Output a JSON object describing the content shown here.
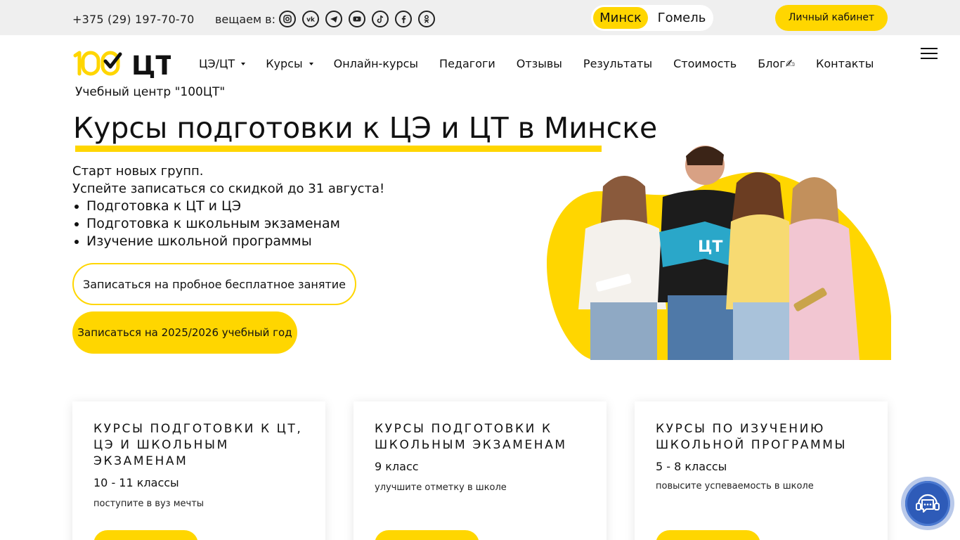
{
  "topbar": {
    "phone": "+375 (29) 197-70-70",
    "broadcast_label": "вещаем в:",
    "socials": [
      "instagram-icon",
      "vk-icon",
      "telegram-icon",
      "youtube-icon",
      "tiktok-icon",
      "facebook-icon",
      "odnoklassniki-icon"
    ],
    "cities": {
      "active": "Минск",
      "other": "Гомель"
    },
    "cabinet_label": "Личный кабинет"
  },
  "nav": {
    "logo_text": "100ЦТ",
    "items": [
      {
        "label": "ЦЭ/ЦТ",
        "dropdown": true
      },
      {
        "label": "Курсы",
        "dropdown": true
      },
      {
        "label": "Онлайн-курсы",
        "dropdown": false
      },
      {
        "label": "Педагоги",
        "dropdown": false
      },
      {
        "label": "Отзывы",
        "dropdown": false
      },
      {
        "label": "Результаты",
        "dropdown": false
      },
      {
        "label": "Стоимость",
        "dropdown": false
      },
      {
        "label": "Блог✍",
        "dropdown": false
      },
      {
        "label": "Контакты",
        "dropdown": false
      }
    ]
  },
  "hero": {
    "subtitle": "Учебный центр \"100ЦТ\"",
    "title": "Курсы подготовки к ЦЭ и ЦТ в Минске",
    "lead_line1": "Старт новых групп.",
    "lead_line2": "Успейте записаться со скидкой до 31 августа!",
    "bullets": [
      "Подготовка к ЦТ и ЦЭ",
      "Подготовка к школьным экзаменам",
      "Изучение школьной программы"
    ],
    "btn_trial": "Записаться на пробное бесплатное занятие",
    "btn_year": "Записаться на 2025/2026 учебный год"
  },
  "cards": [
    {
      "title": "Курсы подготовки к ЦТ, ЦЭ и школьным экзаменам",
      "grade": "10 - 11 классы",
      "note": "поступите в вуз мечты"
    },
    {
      "title": "Курсы подготовки к школьным экзаменам",
      "grade": "9 класс",
      "note": "улучшите отметку в школе"
    },
    {
      "title": "Курсы по изучению школьной программы",
      "grade": "5 - 8 классы",
      "note": "повысите успеваемость в школе"
    }
  ],
  "colors": {
    "accent": "#ffd600",
    "topbar_bg": "#efefef",
    "chat": "#2e5bb8"
  }
}
